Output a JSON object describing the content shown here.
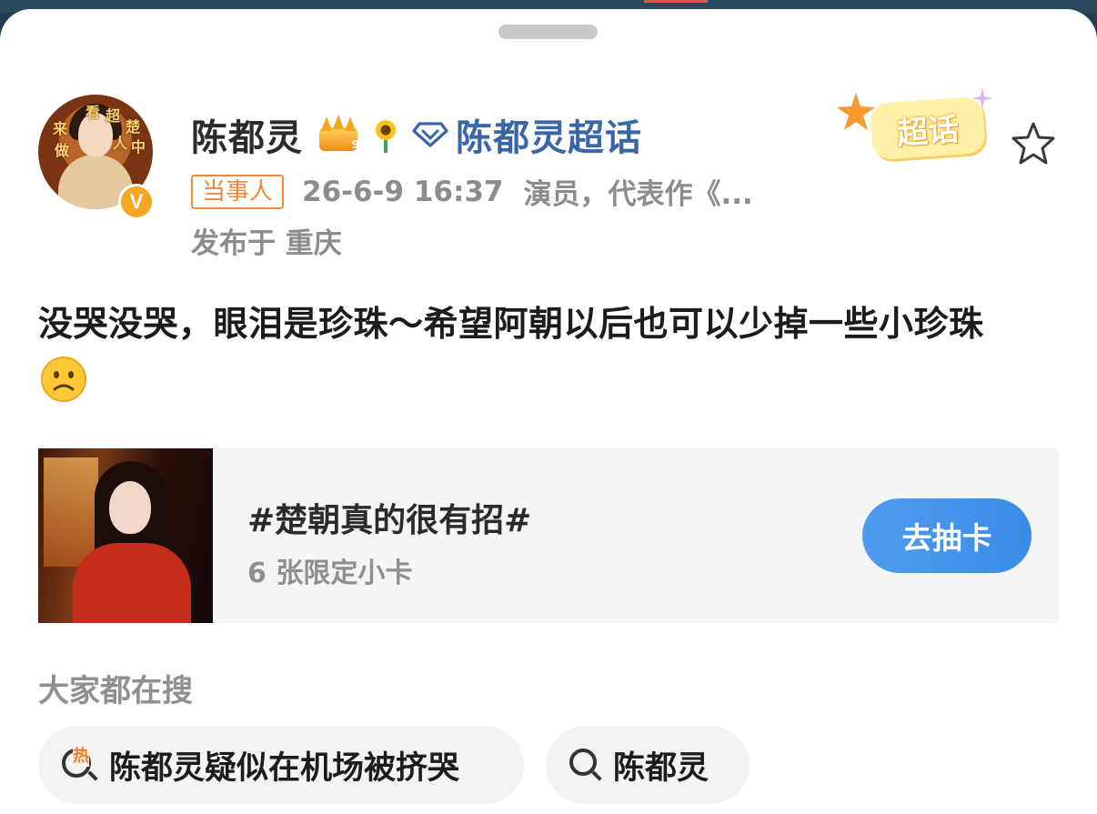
{
  "post": {
    "author": {
      "name": "陈都灵",
      "verified_badge": "V",
      "crown_level": "9",
      "supertopic_link": "陈都灵超话",
      "role_badge": "当事人",
      "timestamp": "26-6-9 16:37",
      "bio": "演员，代表作《...",
      "location": "发布于 重庆"
    },
    "sticker_label": "超话",
    "text": "没哭没哭，眼泪是珍珠～希望阿朝以后也可以少掉一些小珍珠",
    "emoji": "frowning-face",
    "avatar_glyphs": [
      "来",
      "看",
      "超",
      "楚",
      "做",
      "人",
      "中"
    ]
  },
  "card": {
    "title": "#楚朝真的很有招#",
    "subtitle": "6 张限定小卡",
    "button_label": "去抽卡"
  },
  "search": {
    "heading": "大家都在搜",
    "hot_tag": "热",
    "suggestions": [
      {
        "label": "陈都灵疑似在机场被挤哭",
        "icon": "hot-search-icon"
      },
      {
        "label": "陈都灵",
        "icon": "search-icon"
      }
    ]
  },
  "colors": {
    "supertopic_blue": "#3a66a8",
    "badge_orange": "#f0883a",
    "button_blue": "#3a8ce8",
    "meta_gray": "#8c8c8c"
  }
}
